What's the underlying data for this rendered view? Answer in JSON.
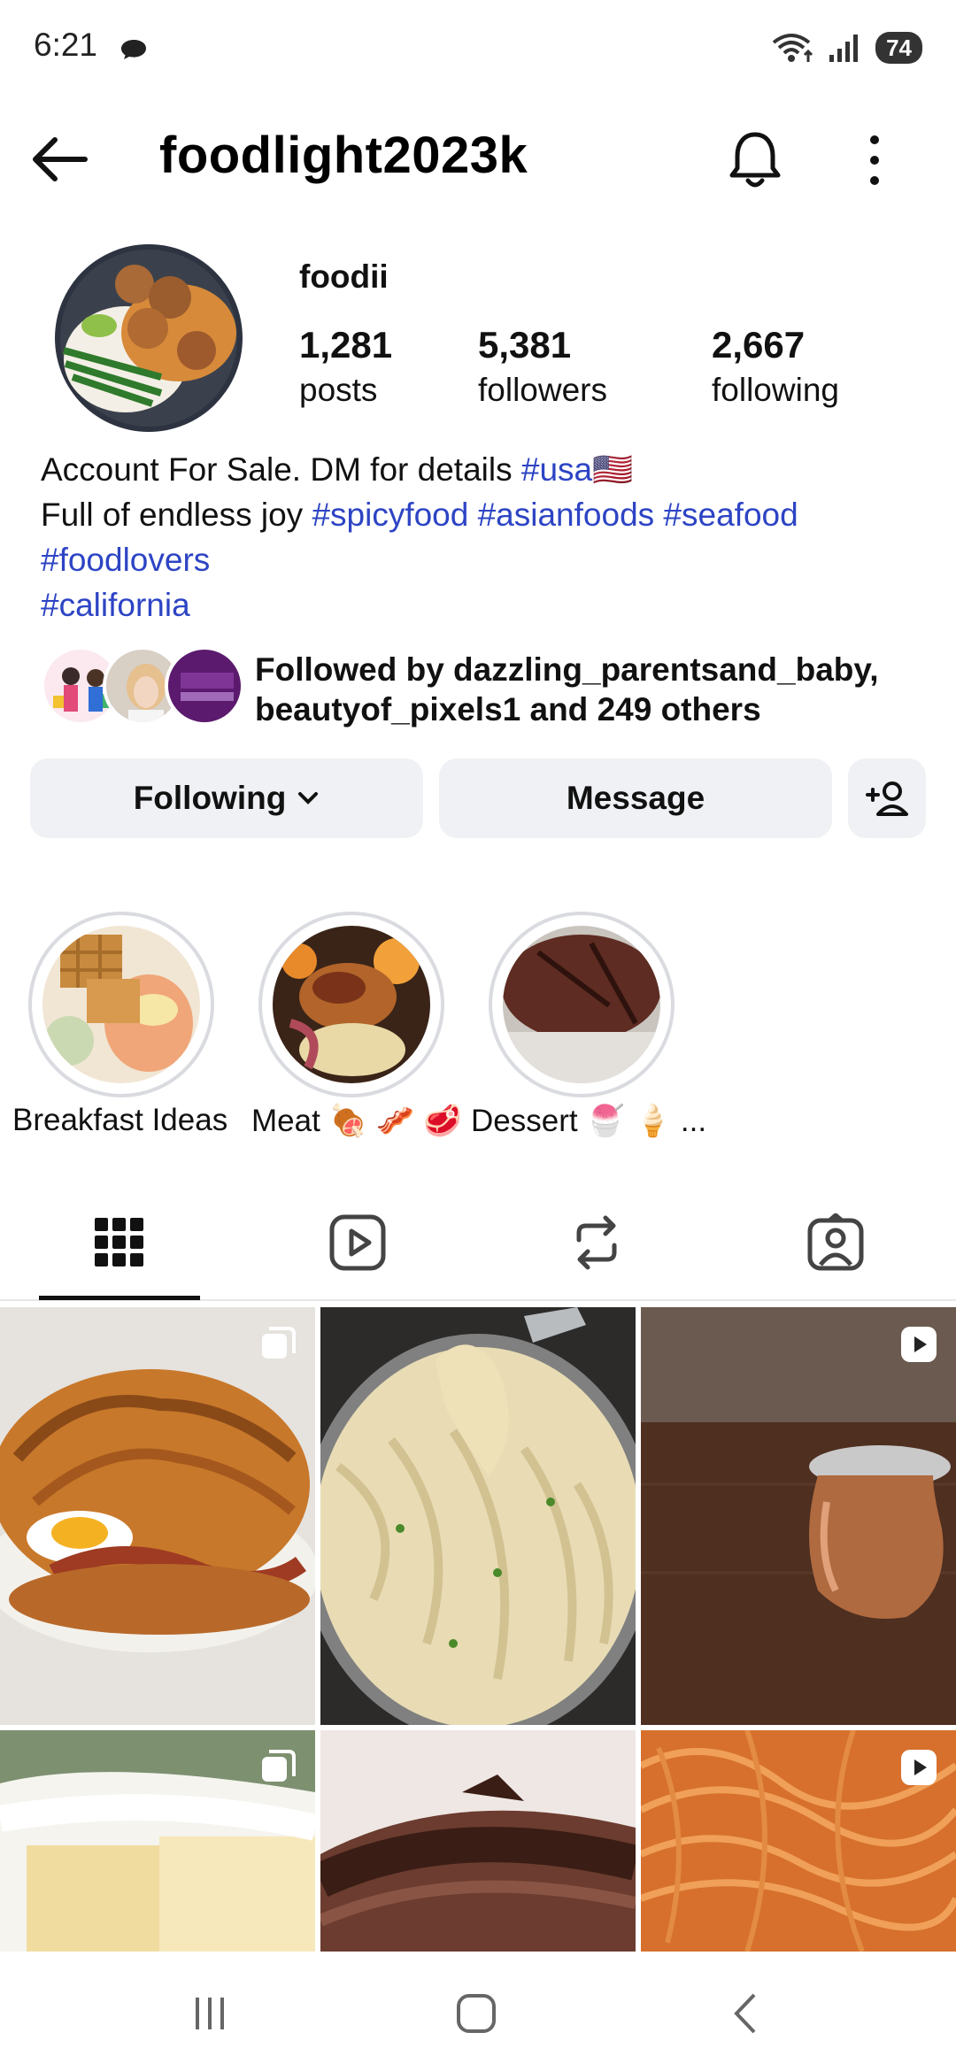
{
  "status_bar": {
    "time": "6:21",
    "battery": "74"
  },
  "header": {
    "title": "foodlight2023k"
  },
  "profile": {
    "display_name": "foodii",
    "stats": [
      {
        "value": "1,281",
        "label": "posts"
      },
      {
        "value": "5,381",
        "label": "followers"
      },
      {
        "value": "2,667",
        "label": "following"
      }
    ],
    "bio": {
      "line1_text": "Account For Sale. DM for details ",
      "line1_tag": "#usa🇺🇸",
      "line2_text": "Full of endless joy ",
      "line2_tags": "#spicyfood #asianfoods #seafood",
      "line3_tag": "#foodlovers",
      "line4_tag": "#california"
    },
    "followed_by_line1": "Followed by dazzling_parentsand_baby,",
    "followed_by_line2": "beautyof_pixels1 and 249 others"
  },
  "actions": {
    "following_label": "Following",
    "message_label": "Message"
  },
  "highlights": [
    {
      "label": "Breakfast Ideas"
    },
    {
      "label": "Meat 🍖 🥓 🥩"
    },
    {
      "label": "Dessert 🍧 🍦 ..."
    }
  ],
  "tabs": [
    "grid-icon",
    "reels-icon",
    "reposts-icon",
    "tagged-icon"
  ],
  "colors": {
    "accent_link": "#2d44c4",
    "button_bg": "#eff1f4"
  }
}
